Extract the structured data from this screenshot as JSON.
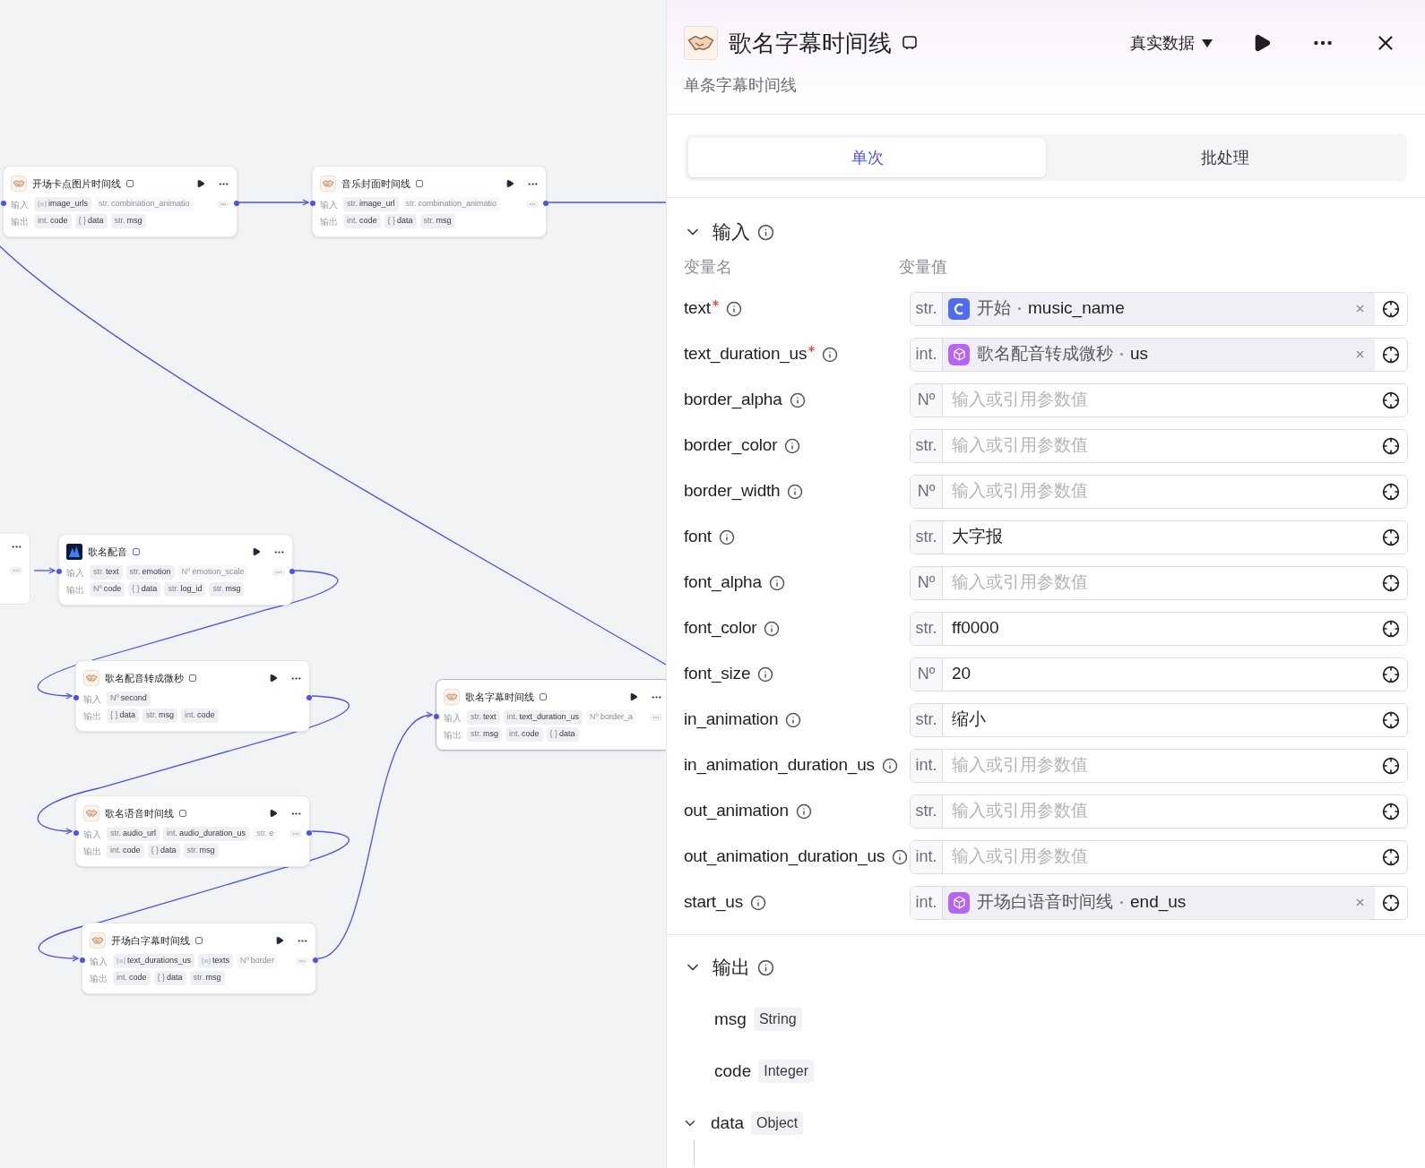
{
  "canvas": {
    "nodes": [
      {
        "title": "开场卡点图片时间线",
        "kind": "plugin",
        "selected": false,
        "input_label": "输入",
        "output_label": "输出",
        "more_inputs": true,
        "inputs": [
          {
            "kind": "list",
            "name": "image_urls",
            "faded": false
          },
          {
            "kind": "typed",
            "type": "str.",
            "name": "combination_animatio",
            "faded": true
          }
        ],
        "outputs": [
          {
            "kind": "typed",
            "type": "int.",
            "name": "code",
            "faded": false
          },
          {
            "kind": "typed",
            "type": "{ }",
            "name": "data",
            "faded": false
          },
          {
            "kind": "typed",
            "type": "str.",
            "name": "msg",
            "faded": false
          }
        ]
      },
      {
        "title": "音乐封面时间线",
        "kind": "plugin",
        "selected": false,
        "input_label": "输入",
        "output_label": "输出",
        "more_inputs": true,
        "inputs": [
          {
            "kind": "typed",
            "type": "str.",
            "name": "image_url",
            "faded": false
          },
          {
            "kind": "typed",
            "type": "str.",
            "name": "combination_animatio",
            "faded": true
          }
        ],
        "outputs": [
          {
            "kind": "typed",
            "type": "int.",
            "name": "code",
            "faded": false
          },
          {
            "kind": "typed",
            "type": "{ }",
            "name": "data",
            "faded": false
          },
          {
            "kind": "typed",
            "type": "str.",
            "name": "msg",
            "faded": false
          }
        ]
      },
      {
        "title": "歌名配音",
        "kind": "model",
        "selected": false,
        "input_label": "输入",
        "output_label": "输出",
        "more_inputs": true,
        "inputs": [
          {
            "kind": "typed",
            "type": "str.",
            "name": "text",
            "faded": false
          },
          {
            "kind": "typed",
            "type": "str.",
            "name": "emotion",
            "faded": false
          },
          {
            "kind": "typed",
            "type": "Nº",
            "name": "emotion_scale",
            "faded": true
          }
        ],
        "outputs": [
          {
            "kind": "typed",
            "type": "Nº",
            "name": "code",
            "faded": false
          },
          {
            "kind": "typed",
            "type": "{ }",
            "name": "data",
            "faded": false
          },
          {
            "kind": "typed",
            "type": "str.",
            "name": "log_id",
            "faded": false
          },
          {
            "kind": "typed",
            "type": "str.",
            "name": "msg",
            "faded": false
          }
        ]
      },
      {
        "title": "歌名配音转成微秒",
        "kind": "plugin",
        "selected": false,
        "input_label": "输入",
        "output_label": "输出",
        "more_inputs": false,
        "inputs": [
          {
            "kind": "typed",
            "type": "Nº",
            "name": "second",
            "faded": false
          }
        ],
        "outputs": [
          {
            "kind": "typed",
            "type": "{ }",
            "name": "data",
            "faded": false
          },
          {
            "kind": "typed",
            "type": "str.",
            "name": "msg",
            "faded": false
          },
          {
            "kind": "typed",
            "type": "int.",
            "name": "code",
            "faded": false
          }
        ]
      },
      {
        "title": "歌名字幕时间线",
        "kind": "plugin",
        "selected": true,
        "input_label": "输入",
        "output_label": "输出",
        "more_inputs": true,
        "inputs": [
          {
            "kind": "typed",
            "type": "str.",
            "name": "text",
            "faded": false
          },
          {
            "kind": "typed",
            "type": "int.",
            "name": "text_duration_us",
            "faded": false
          },
          {
            "kind": "typed",
            "type": "Nº",
            "name": "border_a",
            "faded": true
          }
        ],
        "outputs": [
          {
            "kind": "typed",
            "type": "str.",
            "name": "msg",
            "faded": false
          },
          {
            "kind": "typed",
            "type": "int.",
            "name": "code",
            "faded": false
          },
          {
            "kind": "typed",
            "type": "{ }",
            "name": "data",
            "faded": false
          }
        ]
      },
      {
        "title": "歌名语音时间线",
        "kind": "plugin",
        "selected": false,
        "input_label": "输入",
        "output_label": "输出",
        "more_inputs": true,
        "inputs": [
          {
            "kind": "typed",
            "type": "str.",
            "name": "audio_url",
            "faded": false
          },
          {
            "kind": "typed",
            "type": "int.",
            "name": "audio_duration_us",
            "faded": false
          },
          {
            "kind": "typed",
            "type": "str.",
            "name": "e",
            "faded": true
          }
        ],
        "outputs": [
          {
            "kind": "typed",
            "type": "int.",
            "name": "code",
            "faded": false
          },
          {
            "kind": "typed",
            "type": "{ }",
            "name": "data",
            "faded": false
          },
          {
            "kind": "typed",
            "type": "str.",
            "name": "msg",
            "faded": false
          }
        ]
      },
      {
        "title": "开场白字幕时间线",
        "kind": "plugin",
        "selected": false,
        "input_label": "输入",
        "output_label": "输出",
        "more_inputs": true,
        "inputs": [
          {
            "kind": "list",
            "name": "text_durations_us",
            "faded": false
          },
          {
            "kind": "list",
            "name": "texts",
            "faded": false
          },
          {
            "kind": "typed",
            "type": "Nº",
            "name": "border",
            "faded": true
          }
        ],
        "outputs": [
          {
            "kind": "typed",
            "type": "int.",
            "name": "code",
            "faded": false
          },
          {
            "kind": "typed",
            "type": "{ }",
            "name": "data",
            "faded": false
          },
          {
            "kind": "typed",
            "type": "str.",
            "name": "msg",
            "faded": false
          }
        ]
      }
    ]
  },
  "panel": {
    "title": "歌名字幕时间线",
    "subtitle": "单条字幕时间线",
    "data_mode": "真实数据",
    "tabs": [
      {
        "label": "单次",
        "selected": true
      },
      {
        "label": "批处理",
        "selected": false
      }
    ],
    "input_section": {
      "title": "输入",
      "name_header": "变量名",
      "value_header": "变量值"
    },
    "params": [
      {
        "name": "text",
        "required": true,
        "type": "str.",
        "kind": "ref",
        "ref": {
          "kind": "start",
          "node": "开始",
          "field": "music_name"
        }
      },
      {
        "name": "text_duration_us",
        "required": true,
        "type": "int.",
        "kind": "ref",
        "ref": {
          "kind": "plugin",
          "node": "歌名配音转成微秒",
          "field": "us"
        }
      },
      {
        "name": "border_alpha",
        "required": false,
        "type": "Nº",
        "kind": "empty",
        "placeholder": "输入或引用参数值"
      },
      {
        "name": "border_color",
        "required": false,
        "type": "str.",
        "kind": "empty",
        "placeholder": "输入或引用参数值"
      },
      {
        "name": "border_width",
        "required": false,
        "type": "Nº",
        "kind": "empty",
        "placeholder": "输入或引用参数值"
      },
      {
        "name": "font",
        "required": false,
        "type": "str.",
        "kind": "text",
        "value": "大字报"
      },
      {
        "name": "font_alpha",
        "required": false,
        "type": "Nº",
        "kind": "empty",
        "placeholder": "输入或引用参数值"
      },
      {
        "name": "font_color",
        "required": false,
        "type": "str.",
        "kind": "text",
        "value": "ff0000"
      },
      {
        "name": "font_size",
        "required": false,
        "type": "Nº",
        "kind": "text",
        "value": "20"
      },
      {
        "name": "in_animation",
        "required": false,
        "type": "str.",
        "kind": "text",
        "value": "缩小"
      },
      {
        "name": "in_animation_duration_us",
        "required": false,
        "type": "int.",
        "kind": "empty",
        "placeholder": "输入或引用参数值"
      },
      {
        "name": "out_animation",
        "required": false,
        "type": "str.",
        "kind": "empty",
        "placeholder": "输入或引用参数值"
      },
      {
        "name": "out_animation_duration_us",
        "required": false,
        "type": "int.",
        "kind": "empty",
        "placeholder": "输入或引用参数值"
      },
      {
        "name": "start_us",
        "required": false,
        "type": "int.",
        "kind": "ref",
        "ref": {
          "kind": "plugin",
          "node": "开场白语音时间线",
          "field": "end_us"
        }
      }
    ],
    "output_section": {
      "title": "输出"
    },
    "outputs": [
      {
        "name": "msg",
        "type": "String",
        "kind": "leaf"
      },
      {
        "name": "code",
        "type": "Integer",
        "kind": "leaf"
      },
      {
        "name": "data",
        "type": "Object",
        "kind": "tree"
      }
    ]
  }
}
